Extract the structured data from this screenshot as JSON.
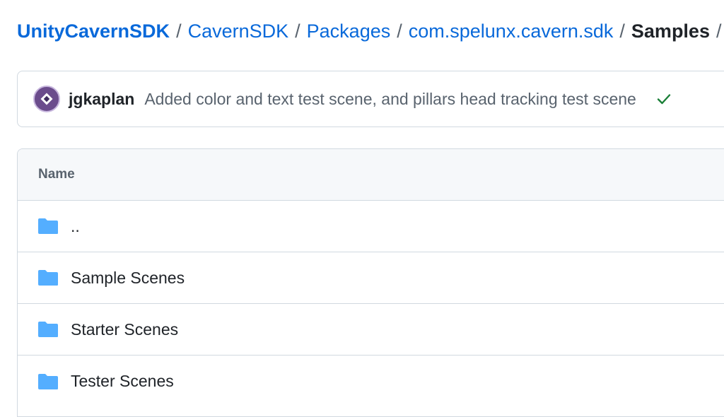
{
  "breadcrumb": {
    "items": [
      "UnityCavernSDK",
      "CavernSDK",
      "Packages",
      "com.spelunx.cavern.sdk"
    ],
    "current": "Samples",
    "separator": "/"
  },
  "commit": {
    "author": "jgkaplan",
    "message": "Added color and text test scene, and pillars head tracking test scene",
    "status_icon": "check-icon",
    "status_color": "#1a7f37"
  },
  "file_table": {
    "header": "Name",
    "rows": [
      {
        "name": "..",
        "icon": "folder-icon"
      },
      {
        "name": "Sample Scenes",
        "icon": "folder-icon"
      },
      {
        "name": "Starter Scenes",
        "icon": "folder-icon"
      },
      {
        "name": "Tester Scenes",
        "icon": "folder-icon"
      }
    ]
  },
  "colors": {
    "link": "#0969da",
    "folder": "#54aeff",
    "border": "#d1d9e0",
    "header_bg": "#f6f8fa"
  }
}
